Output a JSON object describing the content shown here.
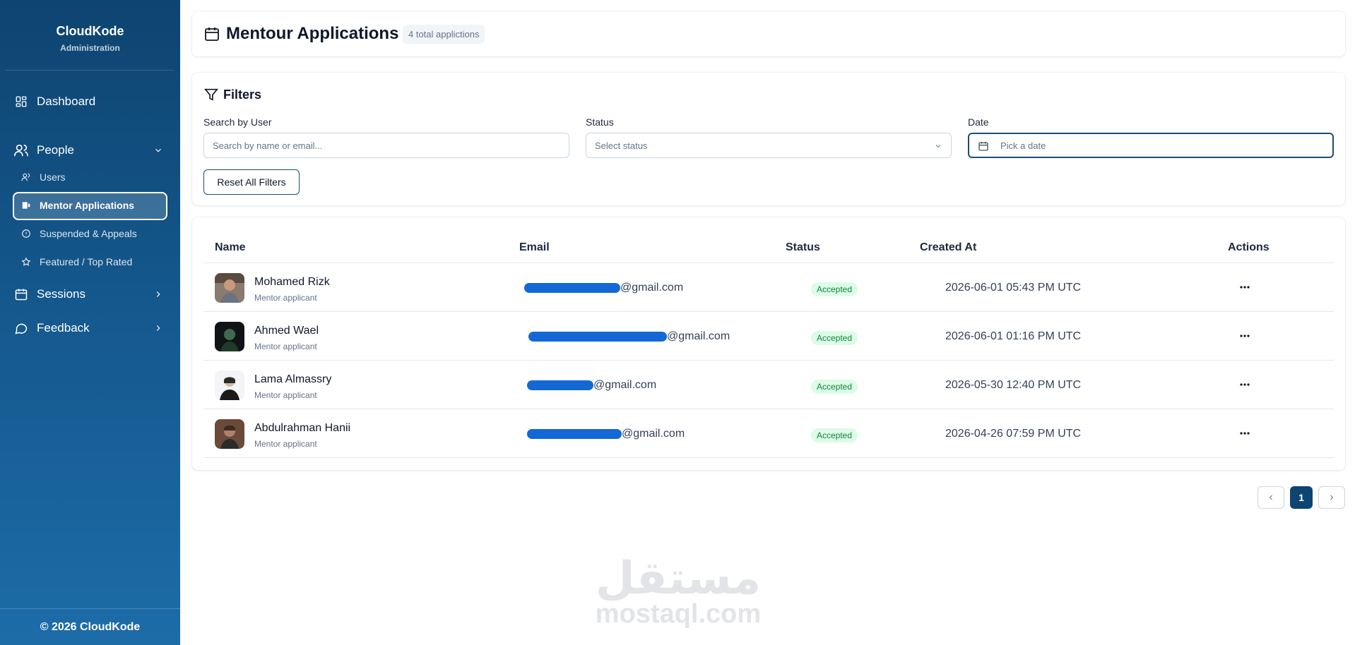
{
  "sidebar": {
    "brand_title": "CloudKode",
    "brand_sub": "Administration",
    "dashboard": "Dashboard",
    "people": "People",
    "users": "Users",
    "mentor_applications": "Mentor Applications",
    "suspended": "Suspended & Appeals",
    "featured": "Featured / Top Rated",
    "sessions": "Sessions",
    "feedback": "Feedback",
    "footer": "© 2026 CloudKode"
  },
  "header": {
    "title": "Mentour Applications",
    "count": "4 total applictions"
  },
  "filters": {
    "title": "Filters",
    "search_label": "Search by User",
    "search_placeholder": "Search by name or email...",
    "status_label": "Status",
    "status_placeholder": "Select status",
    "date_label": "Date",
    "date_placeholder": "Pick a date",
    "reset": "Reset All Filters"
  },
  "table": {
    "columns": {
      "name": "Name",
      "email": "Email",
      "status": "Status",
      "created": "Created At",
      "actions": "Actions"
    },
    "rows": [
      {
        "name": "Mohamed Rizk",
        "role": "Mentor applicant",
        "email": "@gmail.com",
        "status": "Accepted",
        "created": "2026-06-01 05:43 PM UTC"
      },
      {
        "name": "Ahmed Wael",
        "role": "Mentor applicant",
        "email": "@gmail.com",
        "status": "Accepted",
        "created": "2026-06-01 01:16 PM UTC"
      },
      {
        "name": "Lama Almassry",
        "role": "Mentor applicant",
        "email": "@gmail.com",
        "status": "Accepted",
        "created": "2026-05-30 12:40 PM UTC"
      },
      {
        "name": "Abdulrahman Hanii",
        "role": "Mentor applicant",
        "email": "@gmail.com",
        "status": "Accepted",
        "created": "2026-04-26 07:59 PM UTC"
      }
    ]
  },
  "pagination": {
    "current": "1"
  },
  "watermark": {
    "arabic": "مستقل",
    "latin": "mostaql.com"
  },
  "colors": {
    "sidebar_top": "#0e4470",
    "sidebar_bottom": "#1d6ca8",
    "accent": "#0e4470",
    "accepted_bg": "#dcfce7",
    "accepted_text": "#15803d"
  }
}
